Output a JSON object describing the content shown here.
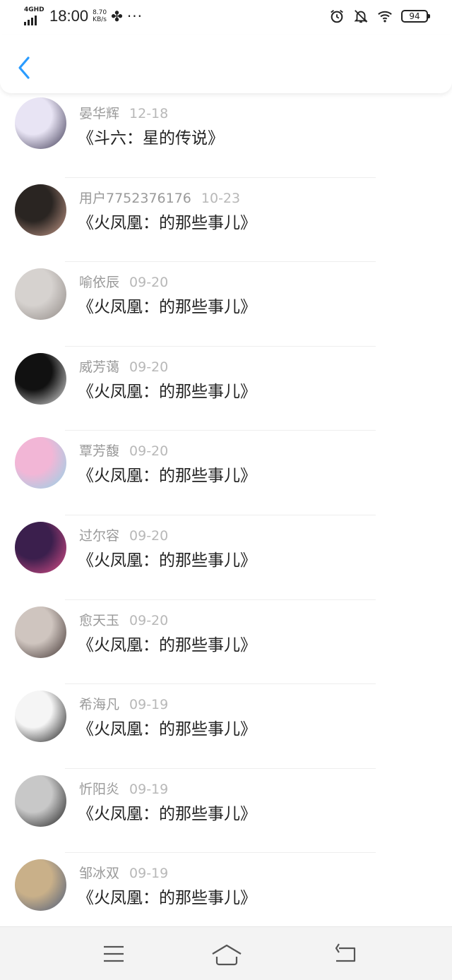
{
  "status_bar": {
    "network": "4GHD",
    "time": "18:00",
    "speed_value": "8.70",
    "speed_unit": "KB/s",
    "more": "···",
    "battery": "94"
  },
  "header": {
    "back_icon": "chevron-left-icon",
    "accent": "#2a9cff"
  },
  "comments": [
    {
      "user": "晏华辉",
      "date": "12-18",
      "title": "《斗六：星的传说》",
      "avatar_colors": [
        "#e8e4f4",
        "#3a3550"
      ]
    },
    {
      "user": "用户7752376176",
      "date": "10-23",
      "title": "《火凤凰：的那些事儿》",
      "avatar_colors": [
        "#2a2522",
        "#c99d8c"
      ]
    },
    {
      "user": "喻依辰",
      "date": "09-20",
      "title": "《火凤凰：的那些事儿》",
      "avatar_colors": [
        "#d6d2cf",
        "#8f8884"
      ]
    },
    {
      "user": "威芳蔼",
      "date": "09-20",
      "title": "《火凤凰：的那些事儿》",
      "avatar_colors": [
        "#111111",
        "#e2e2e2"
      ]
    },
    {
      "user": "覃芳馥",
      "date": "09-20",
      "title": "《火凤凰：的那些事儿》",
      "avatar_colors": [
        "#f2b6d6",
        "#8fd4e8"
      ]
    },
    {
      "user": "过尔容",
      "date": "09-20",
      "title": "《火凤凰：的那些事儿》",
      "avatar_colors": [
        "#3b1f4d",
        "#e04f8a"
      ]
    },
    {
      "user": "愈天玉",
      "date": "09-20",
      "title": "《火凤凰：的那些事儿》",
      "avatar_colors": [
        "#cfc5bf",
        "#3f3230"
      ]
    },
    {
      "user": "希海凡",
      "date": "09-19",
      "title": "《火凤凰：的那些事儿》",
      "avatar_colors": [
        "#f5f5f5",
        "#151515"
      ]
    },
    {
      "user": "忻阳炎",
      "date": "09-19",
      "title": "《火凤凰：的那些事儿》",
      "avatar_colors": [
        "#c8c8c8",
        "#1c1c1c"
      ]
    },
    {
      "user": "邹冰双",
      "date": "09-19",
      "title": "《火凤凰：的那些事儿》",
      "avatar_colors": [
        "#c9b089",
        "#4a5a7a"
      ]
    }
  ],
  "navbar": {
    "menu_icon": "menu-icon",
    "home_icon": "home-icon",
    "back_icon": "back-arrow-icon"
  }
}
